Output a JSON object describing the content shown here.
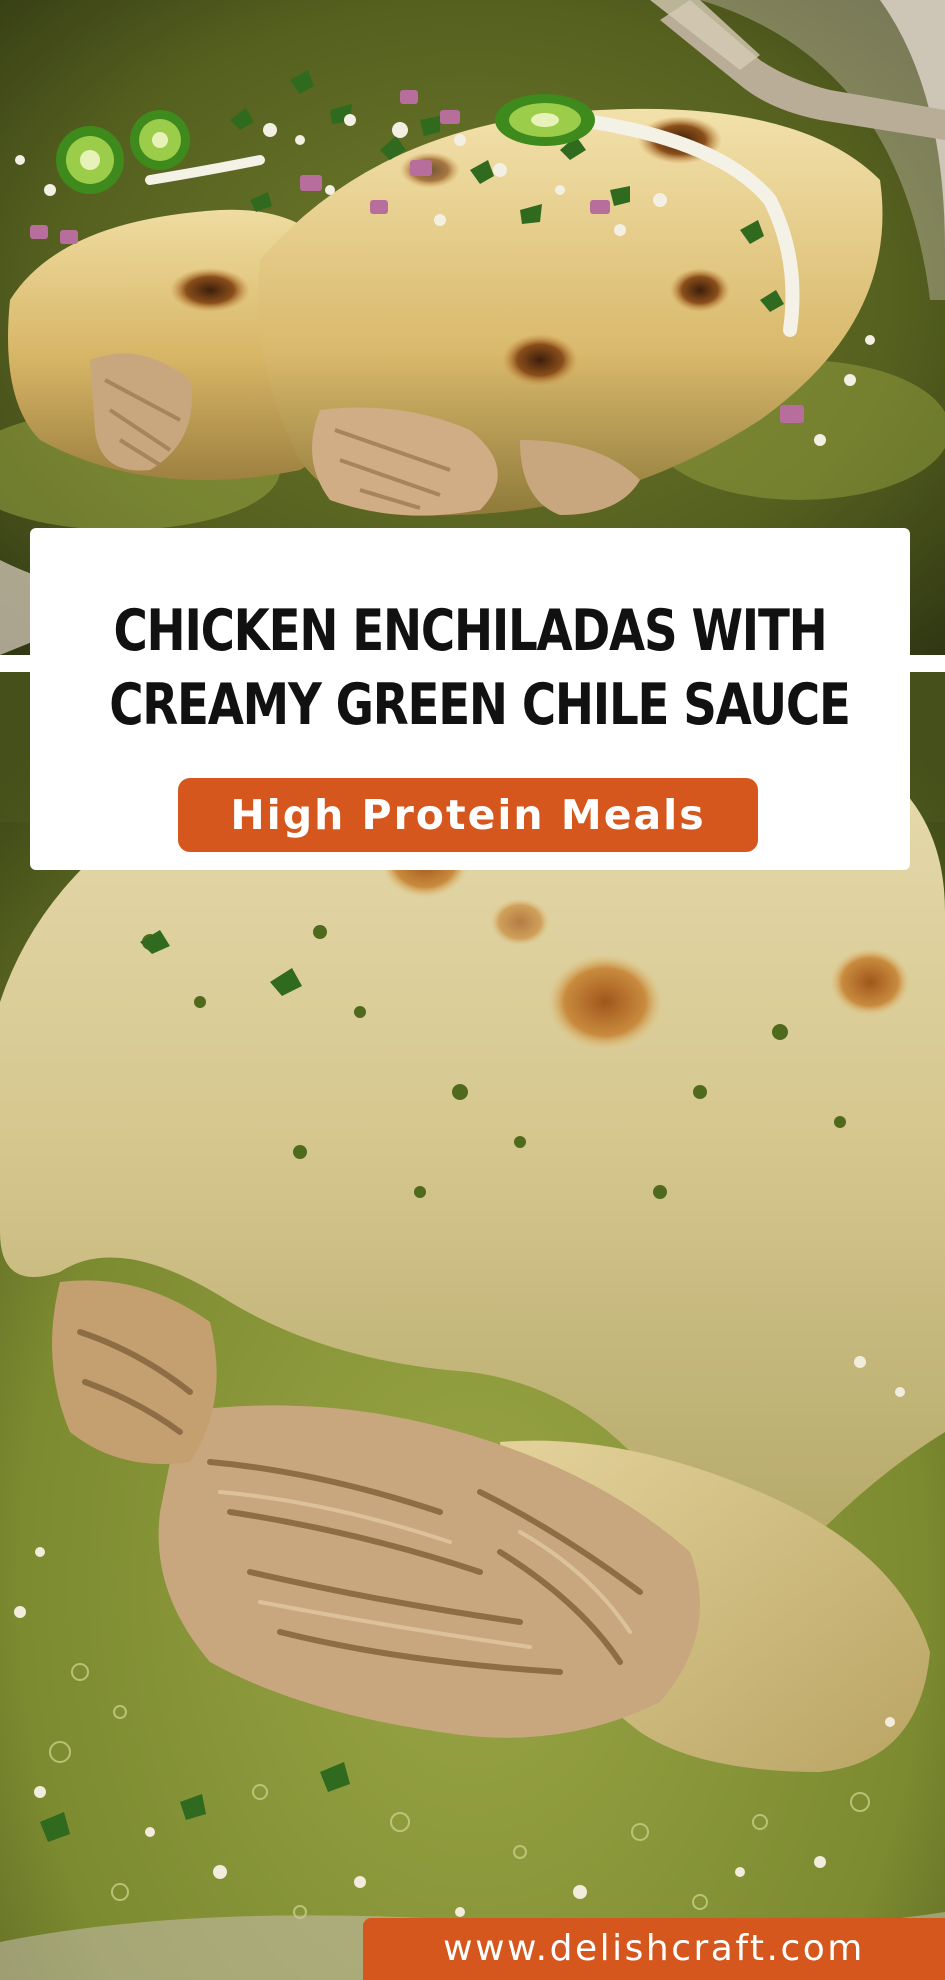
{
  "title": {
    "line1": "CHICKEN ENCHILADAS WITH",
    "line2": "CREAMY GREEN CHILE SAUCE"
  },
  "category": "High Protein Meals",
  "website": "www.delishcraft.com",
  "colors": {
    "accent": "#d6571d",
    "card": "#ffffff",
    "title_text": "#111111",
    "sauce_green": "#8a9a3c",
    "cheese": "#e8d9a8",
    "browned_cheese": "#b8742e",
    "chicken": "#c9a77e"
  },
  "images": {
    "top": "plate-of-chicken-enchiladas-with-green-chile-sauce-topped-with-jalapeno-onion-cotija-cilantro",
    "bottom": "close-up-of-cheesy-enchilada-with-shredded-chicken-in-green-sauce"
  }
}
